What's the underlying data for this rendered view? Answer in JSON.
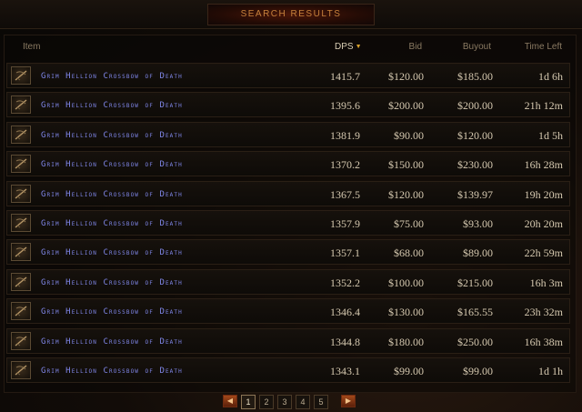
{
  "title": "SEARCH RESULTS",
  "columns": {
    "item": "Item",
    "dps": "DPS",
    "bid": "Bid",
    "buyout": "Buyout",
    "time_left": "Time Left"
  },
  "sort_indicator": "descending",
  "rows": [
    {
      "name": "Grim Hellion Crossbow of Death",
      "dps": "1415.7",
      "bid": "$120.00",
      "buyout": "$185.00",
      "time": "1d 6h"
    },
    {
      "name": "Grim Hellion Crossbow of Death",
      "dps": "1395.6",
      "bid": "$200.00",
      "buyout": "$200.00",
      "time": "21h 12m"
    },
    {
      "name": "Grim Hellion Crossbow of Death",
      "dps": "1381.9",
      "bid": "$90.00",
      "buyout": "$120.00",
      "time": "1d 5h"
    },
    {
      "name": "Grim Hellion Crossbow of Death",
      "dps": "1370.2",
      "bid": "$150.00",
      "buyout": "$230.00",
      "time": "16h 28m"
    },
    {
      "name": "Grim Hellion Crossbow of Death",
      "dps": "1367.5",
      "bid": "$120.00",
      "buyout": "$139.97",
      "time": "19h 20m"
    },
    {
      "name": "Grim Hellion Crossbow of Death",
      "dps": "1357.9",
      "bid": "$75.00",
      "buyout": "$93.00",
      "time": "20h 20m"
    },
    {
      "name": "Grim Hellion Crossbow of Death",
      "dps": "1357.1",
      "bid": "$68.00",
      "buyout": "$89.00",
      "time": "22h 59m"
    },
    {
      "name": "Grim Hellion Crossbow of Death",
      "dps": "1352.2",
      "bid": "$100.00",
      "buyout": "$215.00",
      "time": "16h 3m"
    },
    {
      "name": "Grim Hellion Crossbow of Death",
      "dps": "1346.4",
      "bid": "$130.00",
      "buyout": "$165.55",
      "time": "23h 32m"
    },
    {
      "name": "Grim Hellion Crossbow of Death",
      "dps": "1344.8",
      "bid": "$180.00",
      "buyout": "$250.00",
      "time": "16h 38m"
    },
    {
      "name": "Grim Hellion Crossbow of Death",
      "dps": "1343.1",
      "bid": "$99.00",
      "buyout": "$99.00",
      "time": "1d 1h"
    }
  ],
  "pagination": {
    "pages": [
      "1",
      "2",
      "3",
      "4",
      "5"
    ],
    "current": "1",
    "prev_icon": "triangle-left-icon",
    "next_icon": "triangle-right-icon"
  },
  "colors": {
    "title": "#c7813c",
    "item_name": "#7f86e8",
    "value": "#d6c9b0",
    "header": "#8a7a62",
    "accent": "#d8a12c"
  }
}
